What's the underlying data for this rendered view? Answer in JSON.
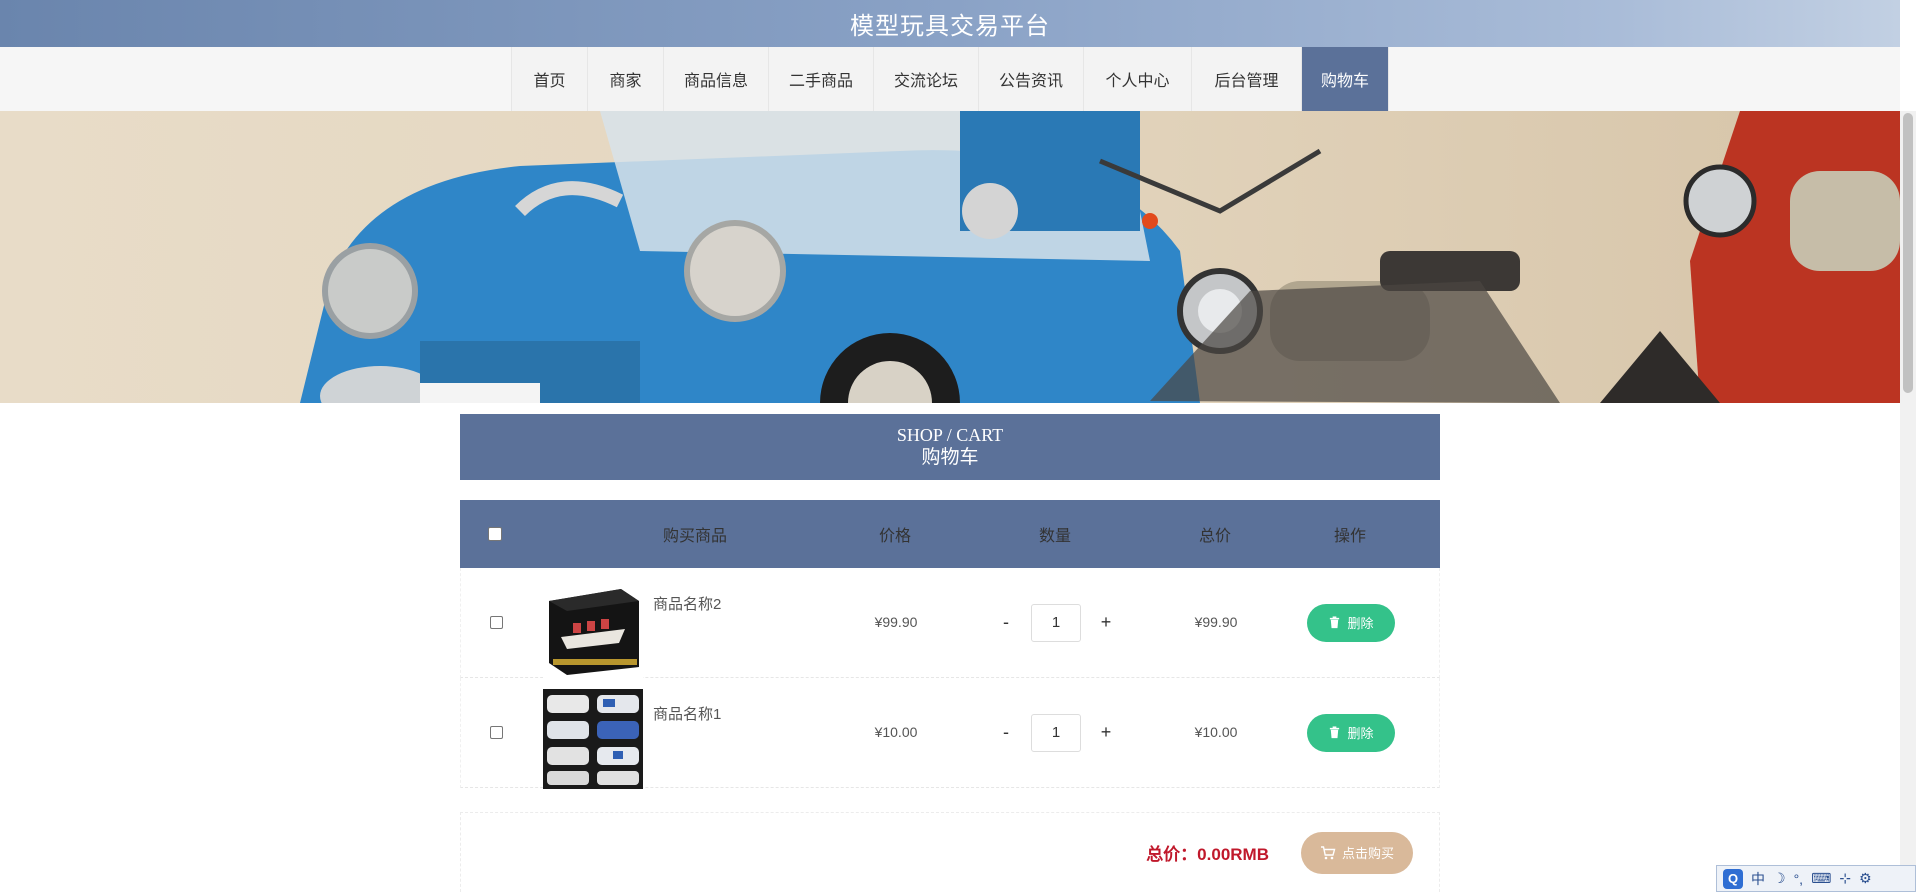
{
  "header": {
    "title": "模型玩具交易平台"
  },
  "nav": {
    "items": [
      {
        "label": "首页",
        "active": false
      },
      {
        "label": "商家",
        "active": false
      },
      {
        "label": "商品信息",
        "active": false
      },
      {
        "label": "二手商品",
        "active": false
      },
      {
        "label": "交流论坛",
        "active": false
      },
      {
        "label": "公告资讯",
        "active": false
      },
      {
        "label": "个人中心",
        "active": false
      },
      {
        "label": "后台管理",
        "active": false
      },
      {
        "label": "购物车",
        "active": true
      }
    ]
  },
  "cart": {
    "title_en": "SHOP / CART",
    "title_cn": "购物车",
    "columns": {
      "product": "购买商品",
      "price": "价格",
      "quantity": "数量",
      "total": "总价",
      "operation": "操作"
    },
    "items": [
      {
        "name": "商品名称2",
        "price": "¥99.90",
        "quantity": "1",
        "total": "¥99.90",
        "thumb": "ship-box"
      },
      {
        "name": "商品名称1",
        "price": "¥10.00",
        "quantity": "1",
        "total": "¥10.00",
        "thumb": "police-cars"
      }
    ],
    "minus_label": "-",
    "plus_label": "+",
    "delete_label": "删除",
    "sum_text": "总价：0.00RMB",
    "buy_label": "点击购买"
  },
  "colors": {
    "primary": "#5b7199",
    "delete": "#34c28a",
    "buy": "#d9b99a",
    "sum": "#c0182b"
  },
  "ime": {
    "labels": [
      "Q",
      "中",
      "☽",
      "°,",
      "⌨",
      "⊹",
      "⚙"
    ]
  }
}
